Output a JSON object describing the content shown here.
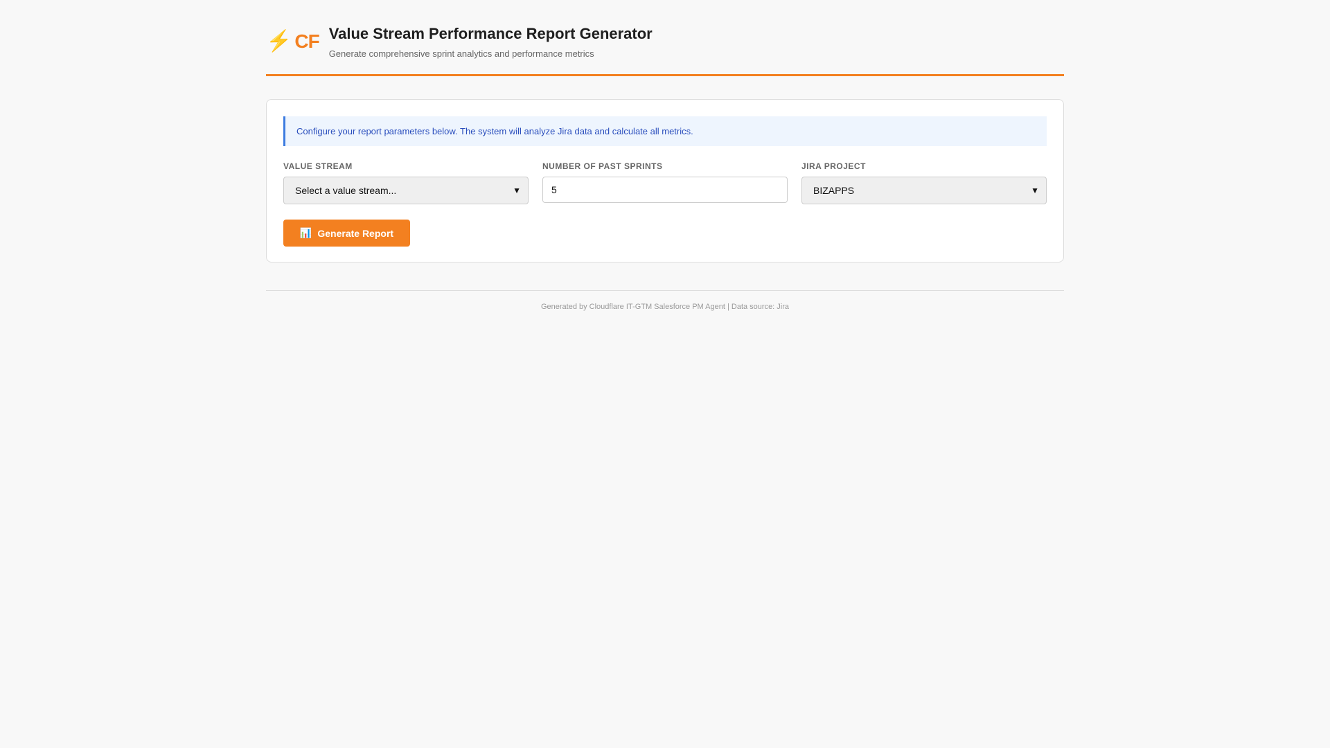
{
  "header": {
    "logo_icon": "lightning-icon",
    "logo_text": "CF",
    "title": "Value Stream Performance Report Generator",
    "subtitle": "Generate comprehensive sprint analytics and performance metrics"
  },
  "form": {
    "info": "Configure your report parameters below. The system will analyze Jira data and calculate all metrics.",
    "value_stream": {
      "label": "VALUE STREAM",
      "selected": "Select a value stream..."
    },
    "sprints": {
      "label": "NUMBER OF PAST SPRINTS",
      "value": "5"
    },
    "project": {
      "label": "JIRA PROJECT",
      "selected": "BIZAPPS"
    },
    "generate_label": "Generate Report",
    "generate_icon": "📊"
  },
  "footer": {
    "text": "Generated by Cloudflare IT-GTM Salesforce PM Agent | Data source: Jira"
  },
  "colors": {
    "accent": "#f38020",
    "info": "#3c7be0"
  }
}
